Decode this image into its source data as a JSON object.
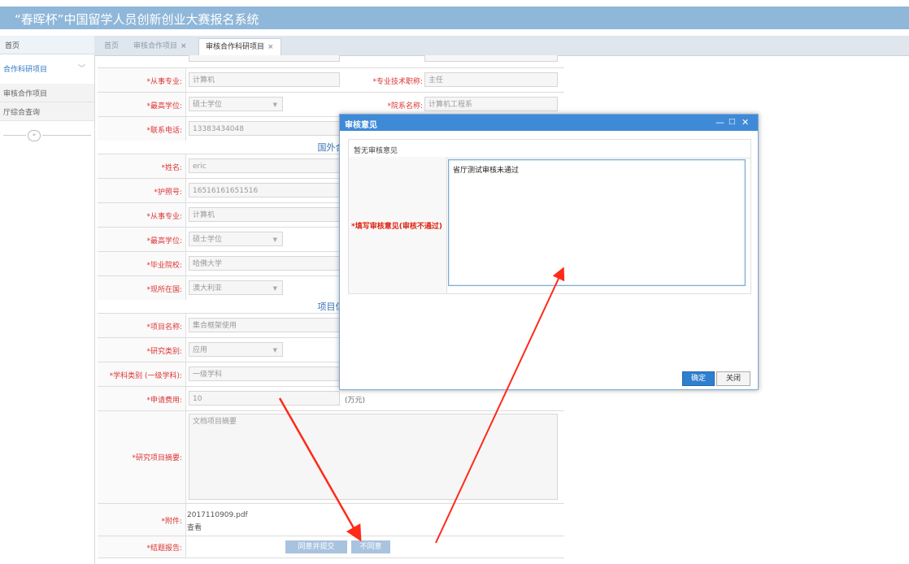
{
  "header": {
    "title": "“春晖杯”中国留学人员创新创业大赛报名系统"
  },
  "sidebar": {
    "home": "首页",
    "group": "合作科研项目",
    "items": [
      "审核合作项目",
      "厅综合查询"
    ]
  },
  "tabs": [
    {
      "label": "首页"
    },
    {
      "label": "审核合作项目",
      "close": "×"
    },
    {
      "label": "审核合作科研项目",
      "close": "×"
    }
  ],
  "form": {
    "rows_top": [
      {
        "label": "*从事专业:",
        "value": "计算机",
        "label2": "*专业技术职称:",
        "value2": "主任"
      },
      {
        "label": "*最高学位:",
        "value": "硕士学位",
        "label2": "*院系名称:",
        "value2": "计算机工程系"
      },
      {
        "label": "*联系电话:",
        "value": "13383434048"
      }
    ],
    "section_foreign": "国外合",
    "rows_foreign": [
      {
        "label": "*姓名:",
        "value": "eric"
      },
      {
        "label": "*护照号:",
        "value": "16516161651516"
      },
      {
        "label": "*从事专业:",
        "value": "计算机"
      },
      {
        "label": "*最高学位:",
        "value": "硕士学位"
      },
      {
        "label": "*毕业院校:",
        "value": "哈佛大学"
      },
      {
        "label": "*现所在国:",
        "value": "澳大利亚"
      }
    ],
    "section_project": "项目信",
    "rows_project": [
      {
        "label": "*项目名称:",
        "value": "集合框架使用"
      },
      {
        "label": "*研究类别:",
        "value": "应用"
      },
      {
        "label": "*学科类别 (一级学科):",
        "value": "一级学科"
      },
      {
        "label": "*申请费用:",
        "value": "10",
        "unit": "(万元)"
      }
    ],
    "summary": {
      "label": "*研究项目摘要:",
      "value": "文档项目摘要"
    },
    "attachment": {
      "label": "*附件:",
      "file": "2017110909.pdf",
      "view": "查看"
    },
    "final": {
      "label": "*结题报告:",
      "agree": "同意并提交",
      "disagree": "不同意"
    }
  },
  "dialog": {
    "title": "审核意见",
    "controls": {
      "min": "—",
      "max": "□",
      "close": "✕"
    },
    "no_opinion": "暂无审核意见",
    "input_label": "*填写审核意见(审核不通过)",
    "input_value": "省厅测试审核未通过",
    "ok": "确定",
    "cancel": "关闭"
  },
  "colors": {
    "header": "#8fb7d9",
    "dialog_title": "#3f8ad6",
    "arrow": "#ff2a1a"
  }
}
